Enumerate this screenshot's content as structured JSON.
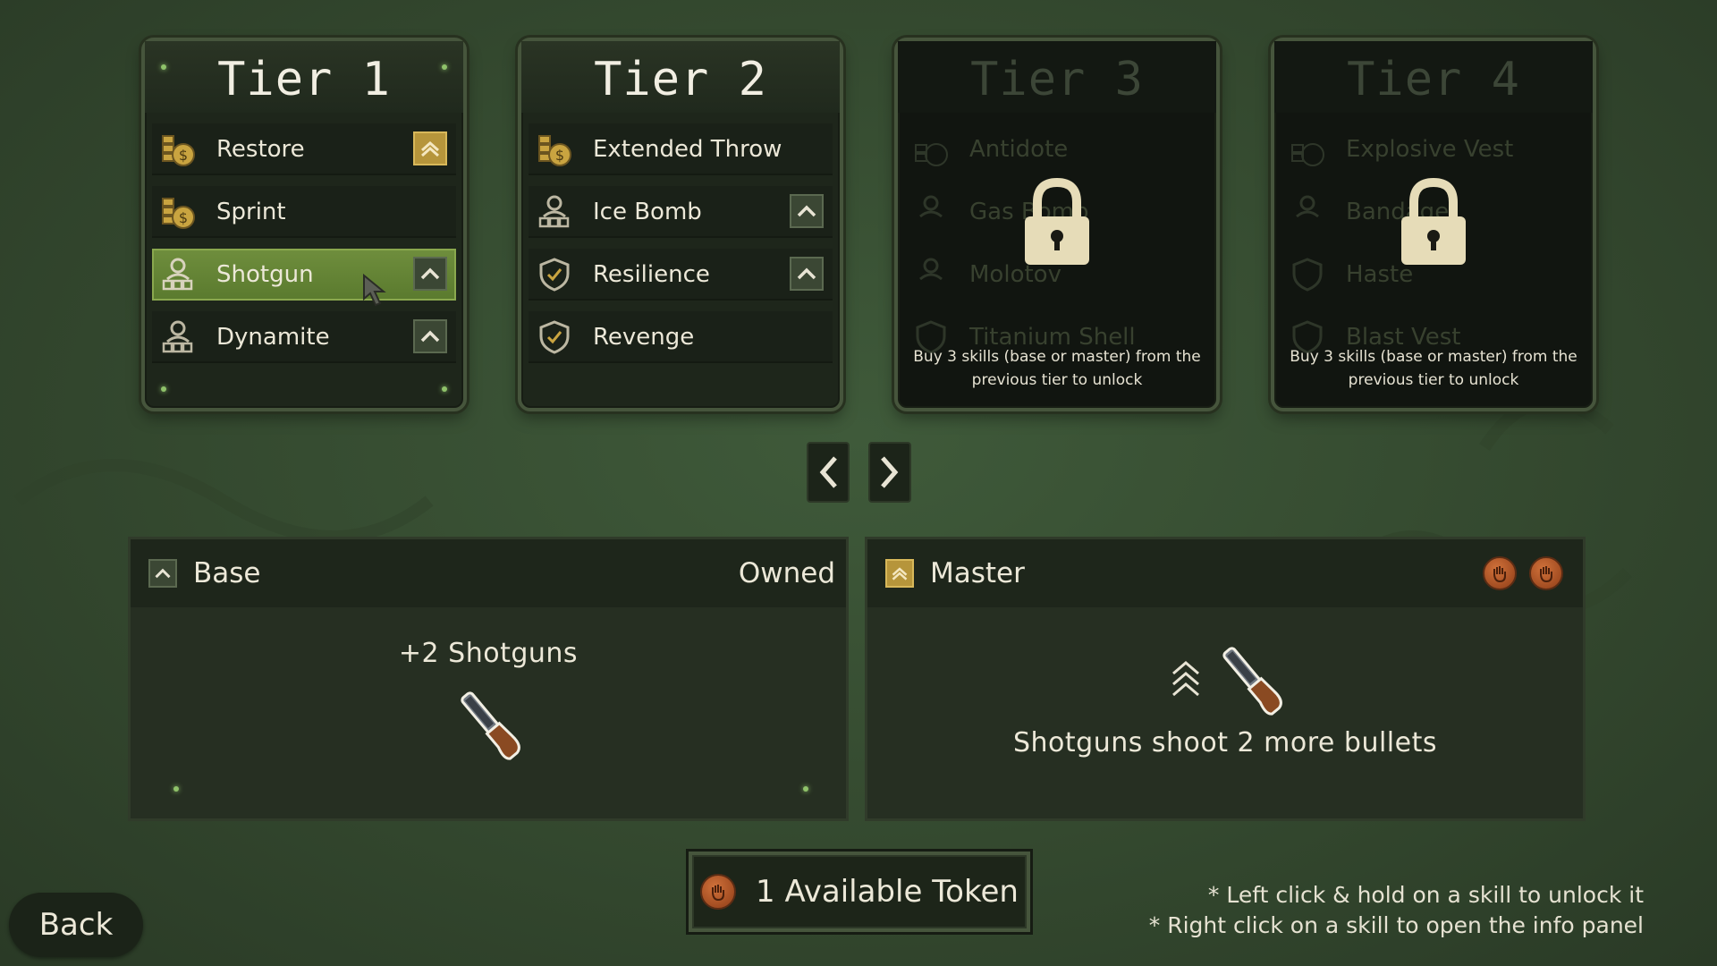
{
  "tiers": [
    {
      "title": "Tier 1",
      "locked": false,
      "skills": [
        {
          "label": "Restore",
          "icon": "coins-icon",
          "badge": "gold"
        },
        {
          "label": "Sprint",
          "icon": "coins-icon",
          "badge": "none"
        },
        {
          "label": "Shotgun",
          "icon": "soldier-icon",
          "badge": "normal",
          "selected": true
        },
        {
          "label": "Dynamite",
          "icon": "soldier-icon",
          "badge": "normal"
        }
      ]
    },
    {
      "title": "Tier 2",
      "locked": false,
      "skills": [
        {
          "label": "Extended Throw",
          "icon": "coins-icon",
          "badge": "none"
        },
        {
          "label": "Ice Bomb",
          "icon": "soldier-icon",
          "badge": "normal"
        },
        {
          "label": "Resilience",
          "icon": "shield-icon",
          "badge": "normal"
        },
        {
          "label": "Revenge",
          "icon": "shield-icon",
          "badge": "none"
        }
      ]
    },
    {
      "title": "Tier 3",
      "locked": true,
      "lock_message_line1": "Buy 3 skills (base or master) from the",
      "lock_message_line2": "previous tier to unlock",
      "skills": [
        {
          "label": "Antidote",
          "icon": "coins-icon"
        },
        {
          "label": "Gas Bomb",
          "icon": "soldier-icon"
        },
        {
          "label": "Molotov",
          "icon": "soldier-icon"
        },
        {
          "label": "Titanium Shell",
          "icon": "shield-icon"
        }
      ]
    },
    {
      "title": "Tier 4",
      "locked": true,
      "lock_message_line1": "Buy 3 skills (base or master) from the",
      "lock_message_line2": "previous tier to unlock",
      "skills": [
        {
          "label": "Explosive Vest",
          "icon": "coins-icon"
        },
        {
          "label": "Bandage",
          "icon": "soldier-icon"
        },
        {
          "label": "Haste",
          "icon": "shield-icon"
        },
        {
          "label": "Blast Vest",
          "icon": "shield-icon"
        }
      ]
    }
  ],
  "navigation": {
    "prev_icon": "chevron-left-icon",
    "next_icon": "chevron-right-icon"
  },
  "base_panel": {
    "title": "Base",
    "status": "Owned",
    "description": "+2 Shotguns",
    "item_icon": "shotgun-icon"
  },
  "master_panel": {
    "title": "Master",
    "cost_tokens": 2,
    "description": "Shotguns shoot 2 more bullets",
    "item_icon": "shotgun-icon",
    "upgrade_icon": "double-chevron-up-icon"
  },
  "tokens": {
    "text": "1 Available Token",
    "icon": "token-hand-icon"
  },
  "back_button": "Back",
  "hints": {
    "line1": "* Left click & hold on a skill to unlock it",
    "line2": "* Right click on a skill to open the info panel"
  },
  "colors": {
    "background": "#34492f",
    "card": "#1e261b",
    "selected": "#6f8e3d",
    "gold_badge": "#b6953b",
    "token": "#c0622d"
  }
}
